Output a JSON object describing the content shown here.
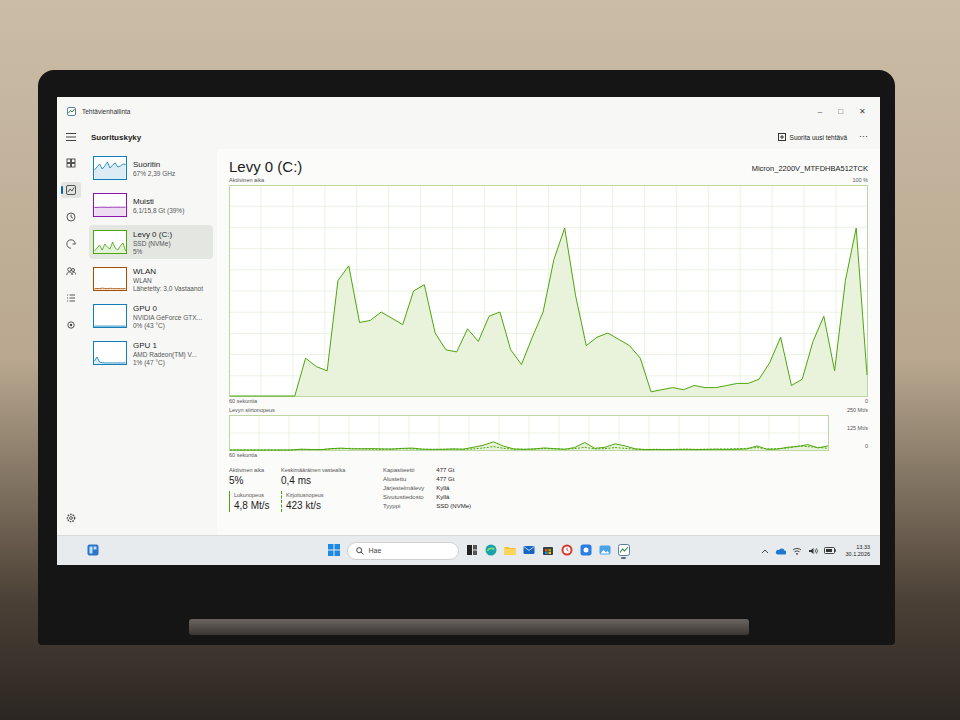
{
  "window": {
    "title": "Tehtävienhallinta",
    "controls": [
      "–",
      "□",
      "✕"
    ]
  },
  "header": {
    "title": "Suorituskyky",
    "run_task": "Suorita uusi tehtävä",
    "more": "⋯"
  },
  "rail": {
    "items": [
      {
        "selected": false
      },
      {
        "selected": true
      },
      {
        "selected": false
      },
      {
        "selected": false
      },
      {
        "selected": false
      },
      {
        "selected": false
      },
      {
        "selected": false
      }
    ]
  },
  "sidebar": {
    "items": [
      {
        "name": "Suoritin",
        "lines": [
          "67% 2,39 GHz"
        ],
        "selected": false,
        "color": "#117dbb",
        "spark": [
          40,
          55,
          70,
          45,
          60,
          80,
          50,
          65,
          75,
          55,
          60,
          70,
          67
        ]
      },
      {
        "name": "Muisti",
        "lines": [
          "6,1/15,8 Gt (39%)"
        ],
        "selected": false,
        "color": "#8b12ae",
        "spark": [
          38,
          38,
          39,
          39,
          39,
          38,
          39,
          39,
          39,
          39,
          39,
          39,
          39
        ]
      },
      {
        "name": "Levy 0 (C:)",
        "lines": [
          "SSD (NVMe)",
          "5%"
        ],
        "selected": true,
        "color": "#4da60c",
        "spark": [
          5,
          20,
          35,
          10,
          40,
          25,
          15,
          50,
          20,
          10,
          30,
          45,
          5
        ]
      },
      {
        "name": "WLAN",
        "lines": [
          "WLAN",
          "Lähetetty: 3,0 Vastaanot"
        ],
        "selected": false,
        "color": "#a74f01",
        "spark": [
          2,
          3,
          2,
          5,
          3,
          2,
          4,
          3,
          2,
          3,
          2,
          2,
          3
        ]
      },
      {
        "name": "GPU 0",
        "lines": [
          "NVIDIA GeForce GTX...",
          "0% (43 °C)"
        ],
        "selected": false,
        "color": "#117dbb",
        "spark": [
          0,
          0,
          0,
          0,
          0,
          0,
          0,
          0,
          0,
          0,
          0,
          0,
          0
        ]
      },
      {
        "name": "GPU 1",
        "lines": [
          "AMD Radeon(TM) V...",
          "1% (47 °C)"
        ],
        "selected": false,
        "color": "#117dbb",
        "spark": [
          10,
          30,
          5,
          2,
          1,
          1,
          1,
          1,
          1,
          1,
          1,
          1,
          1
        ]
      }
    ]
  },
  "detail": {
    "title": "Levy 0 (C:)",
    "model": "Micron_2200V_MTFDHBA512TCK",
    "active_chart": {
      "label": "Aktiivinen aika",
      "max": "100 %",
      "min": "0",
      "time": "60 sekuntia",
      "values": [
        0,
        0,
        0,
        0,
        0,
        0,
        0,
        18,
        14,
        12,
        55,
        62,
        35,
        36,
        40,
        37,
        34,
        50,
        53,
        30,
        22,
        21,
        32,
        26,
        38,
        40,
        22,
        15,
        28,
        40,
        65,
        80,
        48,
        24,
        28,
        30,
        27,
        24,
        18,
        2,
        3,
        4,
        3,
        5,
        4,
        4,
        5,
        6,
        6,
        8,
        16,
        28,
        5,
        8,
        26,
        38,
        12,
        55,
        80,
        10
      ]
    },
    "transfer_chart": {
      "label": "Levyn siirtonopeus",
      "max": "250 Mt/s",
      "mid": "125 Mt/s",
      "min": "0",
      "time": "60 sekuntia",
      "read": [
        0,
        0,
        0,
        0,
        0,
        0,
        0,
        6,
        4,
        3,
        10,
        14,
        8,
        9,
        10,
        8,
        7,
        12,
        14,
        6,
        5,
        5,
        8,
        6,
        20,
        35,
        60,
        28,
        8,
        5,
        8,
        15,
        10,
        5,
        18,
        55,
        12,
        20,
        45,
        30,
        8,
        3,
        4,
        3,
        4,
        5,
        3,
        4,
        5,
        4,
        5,
        8,
        30,
        5,
        6,
        20,
        25,
        40,
        15,
        30
      ],
      "write": [
        0,
        0,
        0,
        0,
        0,
        0,
        0,
        4,
        3,
        3,
        8,
        10,
        12,
        8,
        6,
        5,
        6,
        10,
        8,
        5,
        4,
        5,
        6,
        5,
        8,
        15,
        25,
        12,
        6,
        5,
        6,
        10,
        8,
        6,
        10,
        20,
        8,
        10,
        18,
        12,
        6,
        4,
        5,
        4,
        5,
        6,
        5,
        6,
        7,
        8,
        10,
        12,
        18,
        8,
        10,
        14,
        30,
        25,
        20,
        12
      ]
    },
    "stats": [
      {
        "label": "Aktiivinen aika",
        "value": "5%",
        "kind": "plain"
      },
      {
        "label": "Keskimääräinen vasteaika",
        "value": "0,4 ms",
        "kind": "plain"
      },
      {
        "label": "Lukunopeus",
        "value": "4,8 Mt/s",
        "kind": "solid"
      },
      {
        "label": "Kirjoitusnopeus",
        "value": "423 kt/s",
        "kind": "dashed"
      }
    ],
    "properties": [
      {
        "label": "Kapasiteetti",
        "value": "477 Gt"
      },
      {
        "label": "Alustettu",
        "value": "477 Gt"
      },
      {
        "label": "Järjestelmälevy",
        "value": "Kyllä"
      },
      {
        "label": "Sivutustiedosto",
        "value": "Kyllä"
      },
      {
        "label": "Tyyppi",
        "value": "SSD (NVMe)"
      }
    ]
  },
  "taskbar": {
    "search": "Hae",
    "apps": [
      {
        "active": false
      },
      {
        "active": false
      },
      {
        "active": false
      },
      {
        "active": false
      },
      {
        "active": false
      },
      {
        "active": false
      },
      {
        "active": false
      },
      {
        "active": false
      },
      {
        "active": true
      }
    ],
    "time": "13.33",
    "date": "30.1.2026"
  }
}
